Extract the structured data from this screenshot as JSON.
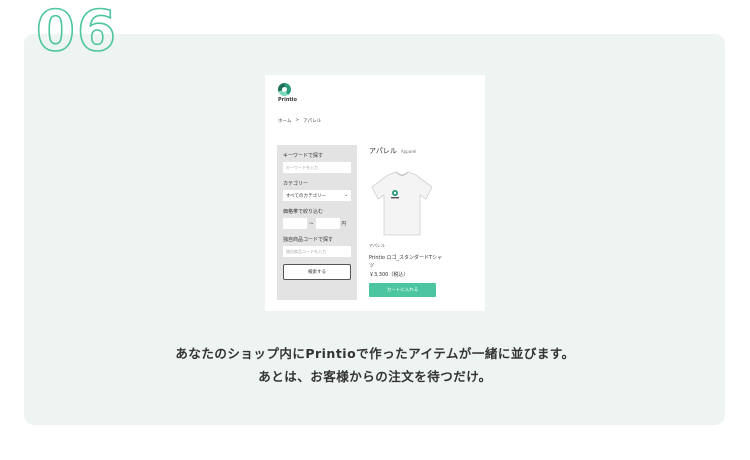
{
  "step": {
    "number": "06"
  },
  "shop": {
    "logo_text": "Printio",
    "breadcrumb": [
      "ホーム",
      ">",
      "アパレル"
    ],
    "sidebar": {
      "keyword_label": "キーワードで探す",
      "keyword_placeholder": "キーワードを入力",
      "category_label": "カテゴリー",
      "category_value": "すべてのカテゴリー",
      "price_label": "価格帯で絞り込む",
      "price_separator": "〜",
      "price_unit": "円",
      "code_label": "独自商品コードで探す",
      "code_placeholder": "独自商品コードを入力",
      "search_button": "検索する"
    },
    "main": {
      "title": "アパレル",
      "title_en": "Apparel",
      "product": {
        "category": "アパレル",
        "name": "Printio ロゴ_スタンダードTシャツ",
        "price": "￥3,300（税込）",
        "cart_button": "カートに入れる"
      }
    }
  },
  "caption": {
    "line1": "あなたのショップ内にPrintioで作ったアイテムが一緒に並びます。",
    "line2": "あとは、お客様からの注文を待つだけ。"
  },
  "colors": {
    "accent": "#4cc6a0",
    "panel_bg": "#eef4f2"
  }
}
